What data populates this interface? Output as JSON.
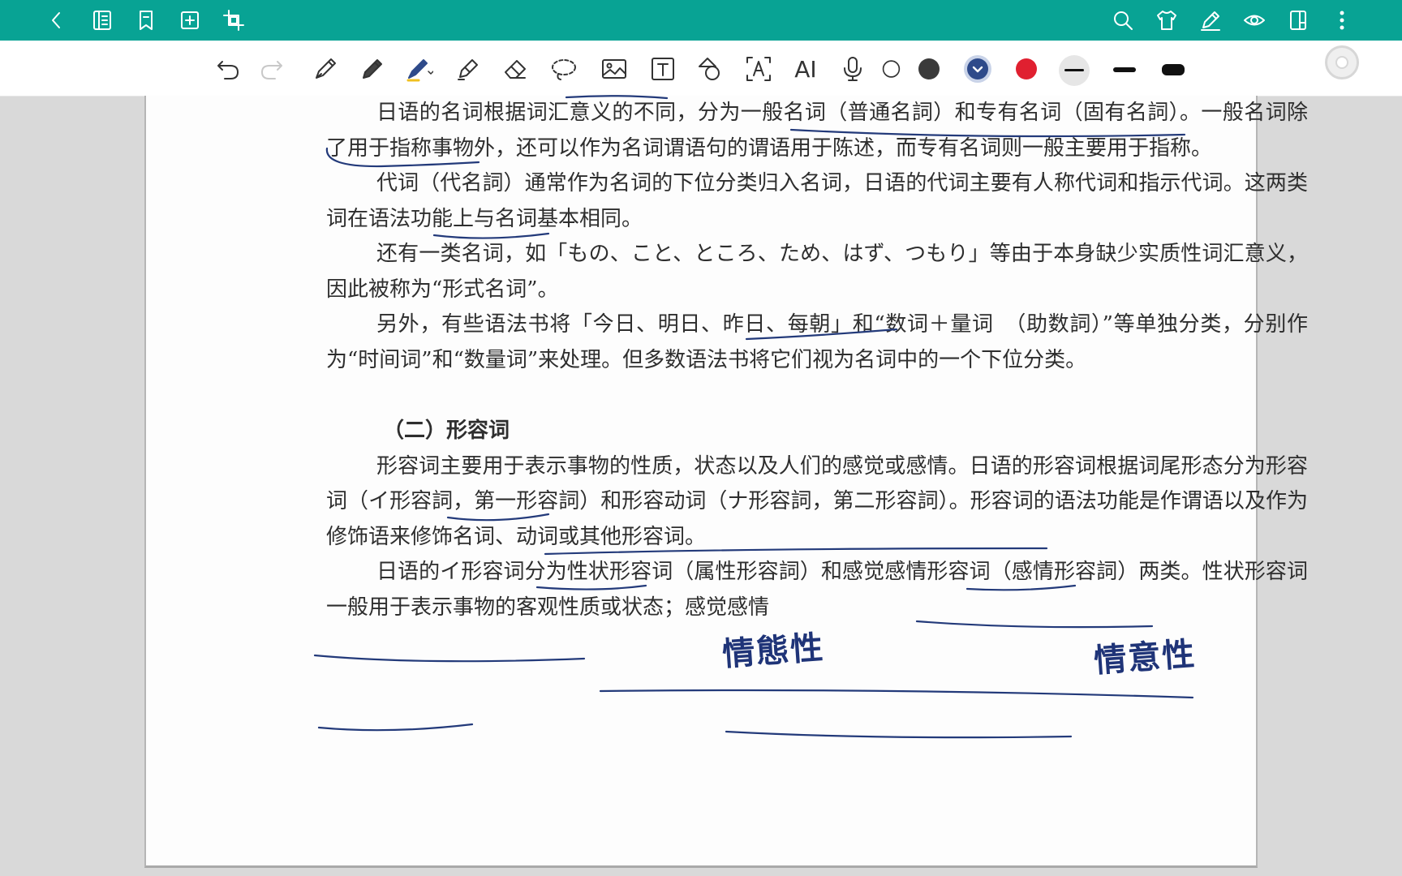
{
  "topbar": {
    "left_icons": [
      "back-icon",
      "outline-icon",
      "bookmark-icon",
      "add-page-icon",
      "crop-icon"
    ],
    "right_icons": [
      "search-icon",
      "theme-shirt-icon",
      "pen-mode-icon",
      "eye-icon",
      "page-layout-icon",
      "more-vertical-icon"
    ]
  },
  "toolbar": {
    "ai_label": "AI",
    "colors": [
      "#3a3a3a",
      "#2e4a8a",
      "#e02030"
    ],
    "selected_color_index": 1
  },
  "document": {
    "paragraphs": [
      "日语的名词根据词汇意义的不同，分为一般名词（普通名詞）和专有名词（固有名詞）。一般名词除了用于指称事物外，还可以作为名词谓语句的谓语用于陈述，而专有名词则一般主要用于指称。",
      "代词（代名詞）通常作为名词的下位分类归入名词，日语的代词主要有人称代词和指示代词。这两类词在语法功能上与名词基本相同。",
      "还有一类名词，如「もの、こと、ところ、ため、はず、つもり」等由于本身缺少实质性词汇意义，因此被称为“形式名词”。",
      "另外，有些语法书将「今日、明日、昨日、每朝」和“数词＋量词　（助数詞）”等单独分类，分别作为“时间词”和“数量词”来处理。但多数语法书将它们视为名词中的一个下位分类。"
    ],
    "section_heading": "（二）形容词",
    "section_paragraphs": [
      "形容词主要用于表示事物的性质，状态以及人们的感觉或感情。日语的形容词根据词尾形态分为形容词（イ形容詞，第一形容詞）和形容动词（ナ形容詞，第二形容詞）。形容词的语法功能是作谓语以及作为修饰语来修饰名词、动词或其他形容词。",
      "日语的イ形容词分为性状形容词（属性形容詞）和感觉感情形容词（感情形容詞）两类。性状形容词一般用于表示事物的客观性质或状态；感觉感情"
    ],
    "handwritten_notes": [
      "情態性",
      "情意性"
    ]
  }
}
